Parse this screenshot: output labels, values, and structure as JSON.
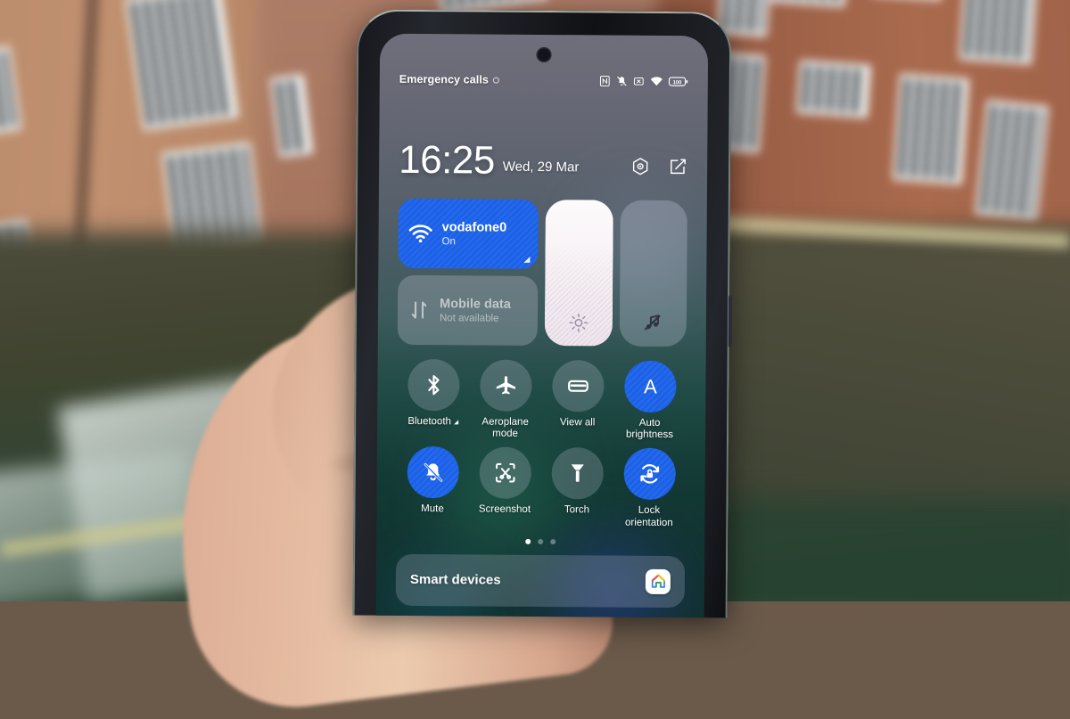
{
  "device": {
    "kind": "android-phone",
    "screen_surface": "quick-settings-shade"
  },
  "status_bar": {
    "carrier_text": "Emergency calls",
    "icons": [
      {
        "name": "nfc-icon",
        "label": "NFC"
      },
      {
        "name": "vibrate-off-icon",
        "label": "Ringer muted"
      },
      {
        "name": "no-sim-icon",
        "label": "No SIM"
      },
      {
        "name": "wifi-icon",
        "label": "Wi-Fi connected"
      },
      {
        "name": "battery-icon",
        "label": "Battery",
        "value": "100"
      }
    ]
  },
  "header": {
    "time": "16:25",
    "date": "Wed, 29 Mar",
    "settings_label": "Settings",
    "edit_label": "Edit"
  },
  "quick_settings": {
    "wifi_tile": {
      "title": "vodafone0",
      "subtitle": "On",
      "state": "on",
      "icon": "wifi-icon"
    },
    "mobile_data_tile": {
      "title": "Mobile data",
      "subtitle": "Not available",
      "state": "off",
      "icon": "data-transfer-icon"
    },
    "brightness_slider": {
      "label": "Brightness",
      "icon": "brightness-icon",
      "level": 100
    },
    "volume_slider": {
      "label": "Volume",
      "icon": "music-off-icon",
      "level": 0
    },
    "tiles": [
      {
        "label": "Bluetooth",
        "icon": "bluetooth-icon",
        "state": "off",
        "has_caret": true
      },
      {
        "label": "Aeroplane\nmode",
        "icon": "airplane-icon",
        "state": "off",
        "has_caret": false
      },
      {
        "label": "View all",
        "icon": "view-all-icon",
        "state": "off",
        "has_caret": false
      },
      {
        "label": "Auto\nbrightness",
        "icon": "auto-brightness-icon",
        "state": "on",
        "has_caret": false
      },
      {
        "label": "Mute",
        "icon": "bell-off-icon",
        "state": "on",
        "has_caret": false
      },
      {
        "label": "Screenshot",
        "icon": "screenshot-icon",
        "state": "off",
        "has_caret": false
      },
      {
        "label": "Torch",
        "icon": "torch-icon",
        "state": "off",
        "has_caret": false
      },
      {
        "label": "Lock\norientation",
        "icon": "rotation-lock-icon",
        "state": "on",
        "has_caret": false
      }
    ],
    "page_dots": {
      "count": 3,
      "active_index": 0
    },
    "smart_devices": {
      "label": "Smart devices",
      "icon": "google-home-icon"
    }
  },
  "colors": {
    "accent_on": "#1b61e8",
    "tile_off": "rgba(190,195,210,0.26)",
    "text_primary": "#ffffff"
  }
}
